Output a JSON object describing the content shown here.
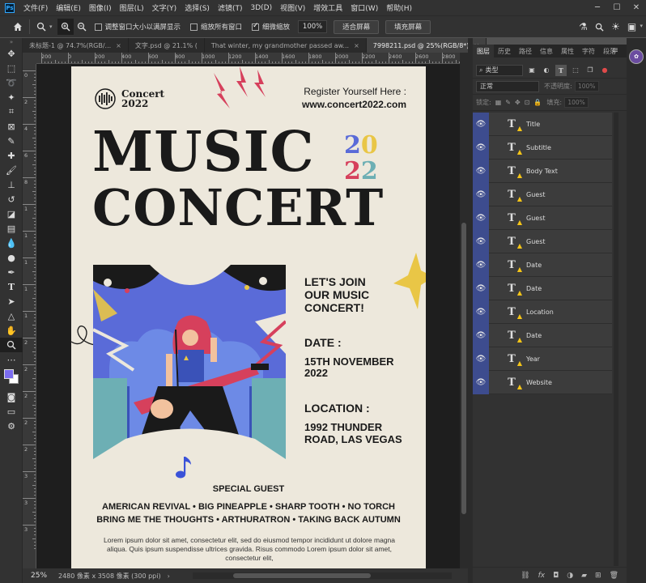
{
  "app": {
    "logo": "Ps",
    "menu": [
      "文件(F)",
      "编辑(E)",
      "图像(I)",
      "图层(L)",
      "文字(Y)",
      "选择(S)",
      "滤镜(T)",
      "3D(D)",
      "视图(V)",
      "增效工具",
      "窗口(W)",
      "帮助(H)"
    ]
  },
  "options": {
    "resize_windows_label": "调整窗口大小以满屏显示",
    "zoom_all_label": "缩放所有窗口",
    "scrubby_zoom_label": "细微缩放",
    "zoom_value": "100%",
    "fit_screen_label": "适合屏幕",
    "fill_screen_label": "填充屏幕"
  },
  "tabs": [
    {
      "label": "未标题-1 @ 74.7%(RGB/..."
    },
    {
      "label": "文字.psd @ 21.1% ("
    },
    {
      "label": "That winter, my grandmother passed aw..."
    },
    {
      "label": "7998211.psd @ 25%(RGB/8*)"
    }
  ],
  "rulers": {
    "top": [
      "200",
      "0",
      "200",
      "400",
      "600",
      "800",
      "1000",
      "1200",
      "1400",
      "1600",
      "1800",
      "2000",
      "2200",
      "2400",
      "2600",
      "2800"
    ],
    "left": [
      "0",
      "2",
      "4",
      "6",
      "8",
      "1",
      "1",
      "1",
      "1",
      "1",
      "2",
      "2",
      "2",
      "2",
      "2",
      "3",
      "3",
      "3"
    ]
  },
  "status": {
    "zoom": "25%",
    "doc_info": "2480 像素 x 3508 像素 (300 ppi)"
  },
  "poster": {
    "logo_line1": "Concert",
    "logo_line2": "2022",
    "register_label": "Register Yourself Here :",
    "website": "www.concert2022.com",
    "title_line1": "MUSIC",
    "title_line2": "CONCERT",
    "year_digits": [
      "2",
      "0",
      "2",
      "2"
    ],
    "join_line1": "LET'S JOIN",
    "join_line2": "OUR MUSIC",
    "join_line3": "CONCERT!",
    "date_label": "DATE :",
    "date_line1": "15TH NOVEMBER",
    "date_line2": "2022",
    "location_label": "LOCATION :",
    "location_line1": "1992 THUNDER",
    "location_line2": "ROAD, LAS VEGAS",
    "special_guest": "SPECIAL GUEST",
    "guests_row1": "AMERICAN REVIVAL  •  BIG PINEAPPLE  •  SHARP TOOTH  •  NO TORCH",
    "guests_row2": "BRING ME THE THOUGHTS  •  ARTHURATRON  •  TAKING BACK AUTUMN",
    "body_line1": "Lorem ipsum dolor sit amet, consectetur elit, sed do eiusmod tempor incididunt ut dolore magna",
    "body_line2": "aliqua. Quis ipsum suspendisse ultrices gravida. Risus commodo Lorem ipsum dolor sit amet, consectetur elit,"
  },
  "panel": {
    "tabs": [
      "图层",
      "历史",
      "路径",
      "信息",
      "属性",
      "字符",
      "段落"
    ],
    "filter_label": "类型",
    "blend_mode": "正常",
    "opacity_label": "不透明度:",
    "opacity_value": "100%",
    "lock_label": "锁定:",
    "fill_label": "填充:",
    "fill_value": "100%",
    "layers": [
      "Title",
      "Subtitle",
      "Body Text",
      "Guest",
      "Guest",
      "Guest",
      "Date",
      "Date",
      "Location",
      "Date",
      "Year",
      "Website"
    ]
  },
  "colors": {
    "poster_bg": "#ede8dc",
    "accent_blue": "#5a6bd8",
    "accent_yellow": "#e9c646",
    "accent_red": "#d6405c",
    "accent_teal": "#6dafb4",
    "foreground_swatch": "#7b6cf0"
  }
}
